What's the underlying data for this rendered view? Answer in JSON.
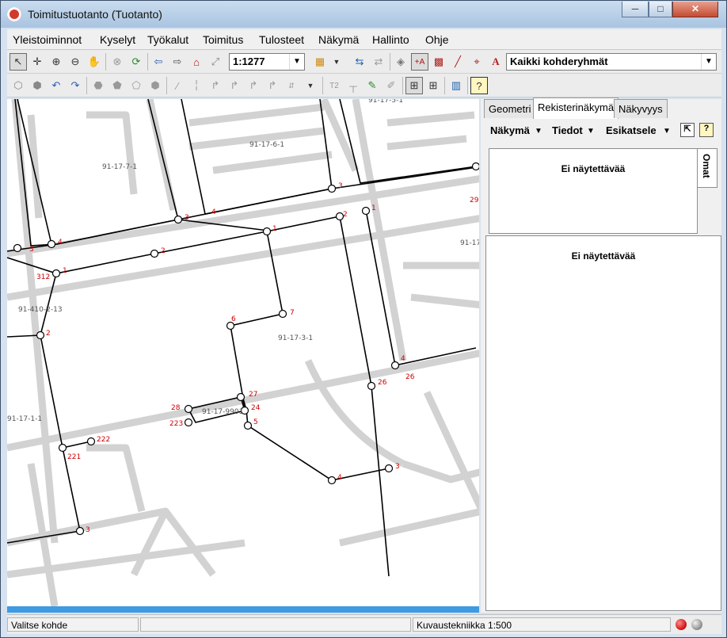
{
  "window": {
    "title": "Toimitustuotanto (Tuotanto)",
    "minimize": "─",
    "maximize": "□",
    "close": "✕"
  },
  "menu": [
    "Yleistoiminnot",
    "Kyselyt",
    "Työkalut",
    "Toimitus",
    "Tulosteet",
    "Näkymä",
    "Hallinto",
    "Ohje"
  ],
  "toolbar1": {
    "scale_value": "1:1277",
    "layer_group": "Kaikki kohderyhmät",
    "text_tool_label": "A"
  },
  "toolbar2": {
    "t2_label": "T2"
  },
  "map": {
    "parcel_labels": [
      "91-17-7-1",
      "91-17-6-1",
      "91-17-3-1",
      "91-410-2-13",
      "91-17-1-1",
      "91-17-9901",
      "91-17",
      "91-17-5-1"
    ],
    "point_numbers": [
      "3",
      "4",
      "3",
      "4",
      "3",
      "2",
      "1",
      "312",
      "2",
      "2",
      "1",
      "6",
      "7",
      "4",
      "26",
      "26",
      "27",
      "24",
      "5",
      "28",
      "223",
      "222",
      "221",
      "3",
      "4",
      "3",
      "1",
      "29"
    ]
  },
  "side": {
    "tabs": [
      "Geometri",
      "Rekisterinäkymä",
      "Näkyvyys"
    ],
    "toolbar": [
      "Näkymä",
      "Tiedot",
      "Esikatsele"
    ],
    "vertical_tab": "Omat",
    "empty_top": "Ei näytettävää",
    "empty_bottom": "Ei näytettävää"
  },
  "status": {
    "message": "Valitse kohde",
    "technique": "Kuvaustekniikka 1:500"
  },
  "colors": {
    "led_red": "#d81e1e",
    "led_gray": "#9a9a9a",
    "scroll_blue": "#3f9ae2",
    "point_label": "#cc0000"
  }
}
